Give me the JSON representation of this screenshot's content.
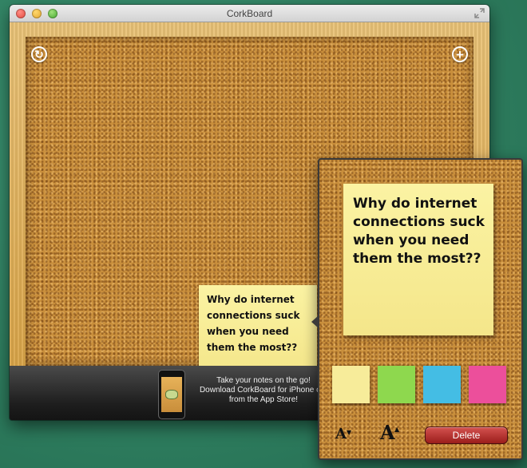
{
  "window": {
    "title": "CorkBoard"
  },
  "note": {
    "text": "Why do internet connections suck when you need them the most??"
  },
  "footer": {
    "promo_line1": "Take your notes on the go!",
    "promo_line2": "Download CorkBoard for iPhone or i",
    "promo_line3": "from the App Store!"
  },
  "editor": {
    "colors": [
      {
        "name": "yellow",
        "hex": "#f7ec9a"
      },
      {
        "name": "green",
        "hex": "#8ed84e"
      },
      {
        "name": "blue",
        "hex": "#44bde4"
      },
      {
        "name": "pink",
        "hex": "#ec4f9b"
      }
    ],
    "font_smaller_label": "A",
    "font_larger_label": "A",
    "delete_label": "Delete"
  },
  "icons": {
    "refresh": "refresh-icon",
    "add": "plus-icon"
  }
}
